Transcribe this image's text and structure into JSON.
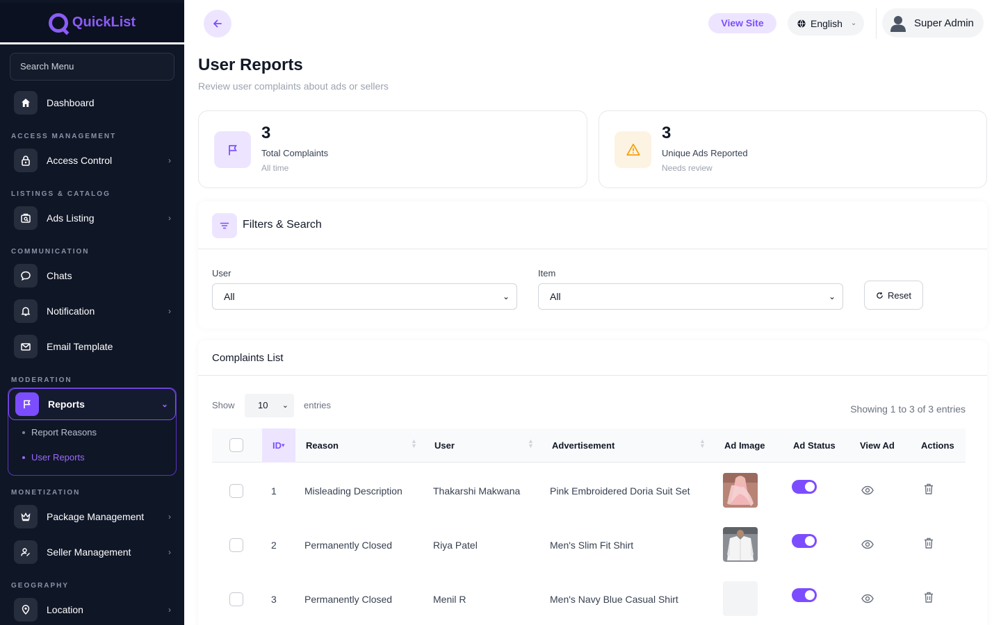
{
  "app": {
    "name": "QuickList"
  },
  "sidebar": {
    "search_placeholder": "Search Menu",
    "dashboard": "Dashboard",
    "sections": {
      "access": "ACCESS MANAGEMENT",
      "listings": "LISTINGS & CATALOG",
      "communication": "COMMUNICATION",
      "moderation": "MODERATION",
      "monetization": "MONETIZATION",
      "geography": "GEOGRAPHY"
    },
    "items": {
      "access_control": "Access Control",
      "ads_listing": "Ads Listing",
      "chats": "Chats",
      "notification": "Notification",
      "email_template": "Email Template",
      "reports": "Reports",
      "report_reasons": "Report Reasons",
      "user_reports": "User Reports",
      "package_management": "Package Management",
      "seller_management": "Seller Management",
      "location": "Location"
    }
  },
  "header": {
    "view_site": "View Site",
    "language": "English",
    "user": "Super Admin"
  },
  "page": {
    "title": "User Reports",
    "subtitle": "Review user complaints about ads or sellers"
  },
  "stats": [
    {
      "value": "3",
      "label": "Total Complaints",
      "note": "All time"
    },
    {
      "value": "3",
      "label": "Unique Ads Reported",
      "note": "Needs review"
    }
  ],
  "filters": {
    "title": "Filters & Search",
    "user_label": "User",
    "user_value": "All",
    "item_label": "Item",
    "item_value": "All",
    "reset": "Reset"
  },
  "list": {
    "title": "Complaints List",
    "show": "Show",
    "page_size": "10",
    "entries": "entries",
    "showing": "Showing 1 to 3 of 3 entries",
    "columns": [
      "ID",
      "Reason",
      "User",
      "Advertisement",
      "Ad Image",
      "Ad Status",
      "View Ad",
      "Actions"
    ],
    "rows": [
      {
        "id": "1",
        "reason": "Misleading Description",
        "user": "Thakarshi Makwana",
        "ad": "Pink Embroidered Doria Suit Set",
        "status_on": true
      },
      {
        "id": "2",
        "reason": "Permanently Closed",
        "user": "Riya Patel",
        "ad": "Men's Slim Fit Shirt",
        "status_on": true
      },
      {
        "id": "3",
        "reason": "Permanently Closed",
        "user": "Menil R",
        "ad": "Men's Navy Blue Casual Shirt",
        "status_on": true
      }
    ]
  },
  "colors": {
    "accent": "#7c4dff",
    "sidebar_bg": "#0f1626",
    "warning": "#f59e0b"
  }
}
